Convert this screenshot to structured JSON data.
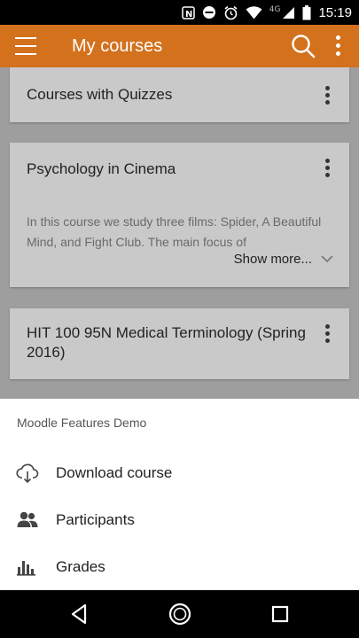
{
  "status_bar": {
    "time": "15:19",
    "network": "4G"
  },
  "app_bar": {
    "title": "My courses"
  },
  "courses": [
    {
      "title": "Courses with Quizzes"
    },
    {
      "title": "Psychology in Cinema",
      "summary": "In this course we study three films: Spider, A Beautiful Mind, and Fight Club. The main focus of",
      "show_more": "Show more..."
    },
    {
      "title": "HIT 100 95N Medical Terminology (Spring 2016)"
    }
  ],
  "sheet": {
    "title": "Moodle Features Demo",
    "items": [
      {
        "label": "Download course",
        "icon": "cloud-download-icon"
      },
      {
        "label": "Participants",
        "icon": "people-icon"
      },
      {
        "label": "Grades",
        "icon": "bar-chart-icon"
      }
    ]
  },
  "colors": {
    "accent": "#d3711d",
    "scrim": "#9e9e9e",
    "card": "#c9c9c9"
  }
}
